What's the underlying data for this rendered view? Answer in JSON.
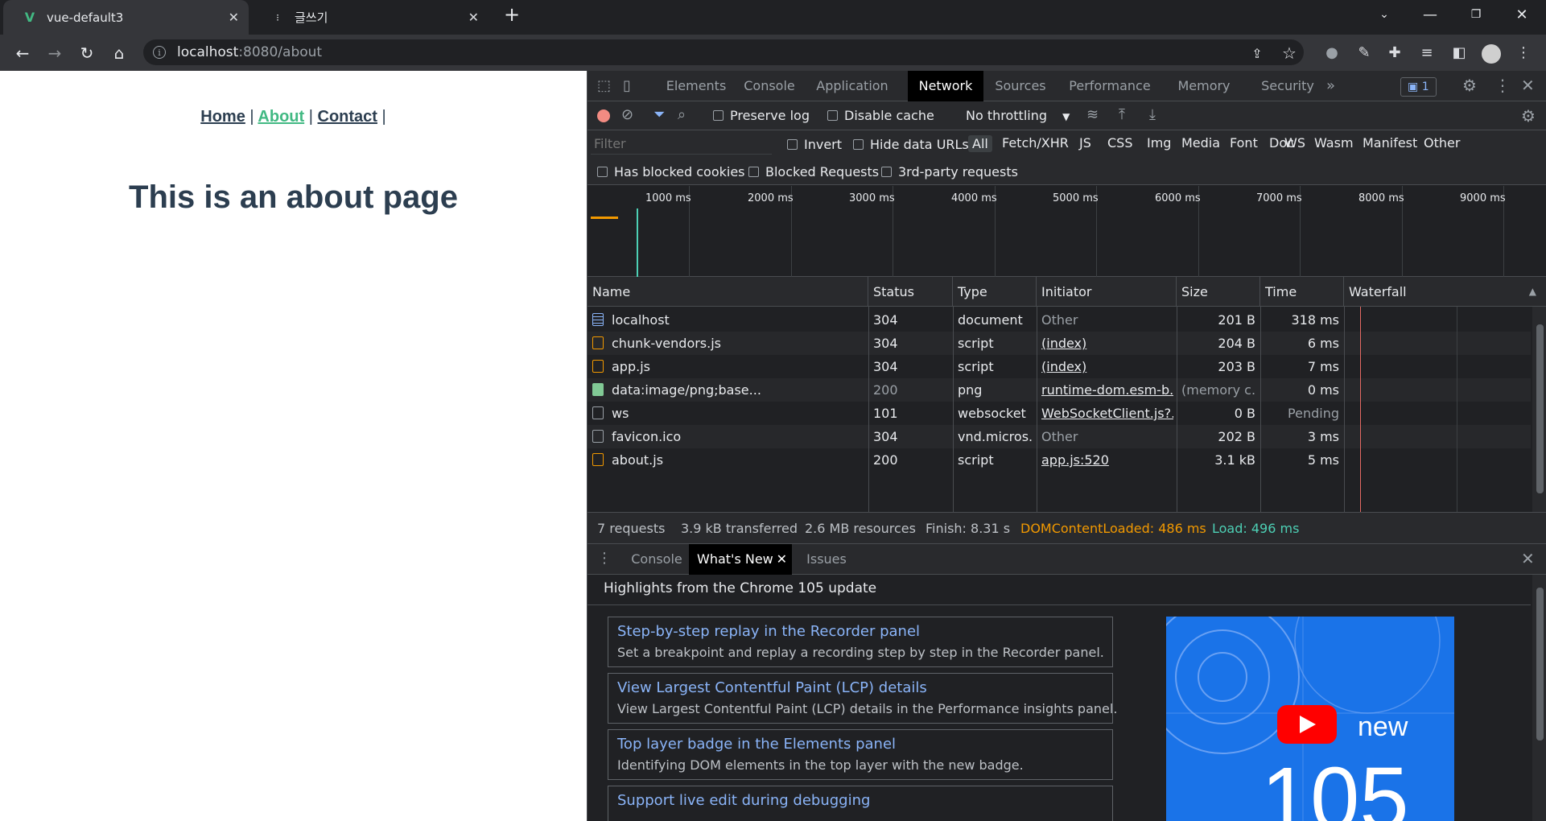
{
  "browser": {
    "tabs": [
      {
        "title": "vue-default3",
        "active": true
      },
      {
        "title": "글쓰기",
        "active": false
      }
    ],
    "url_host": "localhost",
    "url_path": ":8080/about"
  },
  "page": {
    "nav": {
      "home": "Home",
      "about": "About",
      "contact": "Contact",
      "sep": "|"
    },
    "heading": "This is an about page"
  },
  "devtools": {
    "tabs": [
      "Elements",
      "Console",
      "Application",
      "Network",
      "Sources",
      "Performance",
      "Memory",
      "Security"
    ],
    "selected_tab": "Network",
    "issues_badge": "1",
    "toolbar": {
      "preserve_log": "Preserve log",
      "disable_cache": "Disable cache",
      "throttling": "No throttling"
    },
    "filter": {
      "placeholder": "Filter",
      "invert": "Invert",
      "hide_data_urls": "Hide data URLs",
      "types": [
        "All",
        "Fetch/XHR",
        "JS",
        "CSS",
        "Img",
        "Media",
        "Font",
        "Doc",
        "WS",
        "Wasm",
        "Manifest",
        "Other"
      ],
      "has_blocked_cookies": "Has blocked cookies",
      "blocked_requests": "Blocked Requests",
      "third_party": "3rd-party requests"
    },
    "overview_ticks": [
      "1000 ms",
      "2000 ms",
      "3000 ms",
      "4000 ms",
      "5000 ms",
      "6000 ms",
      "7000 ms",
      "8000 ms",
      "9000 ms"
    ],
    "columns": [
      "Name",
      "Status",
      "Type",
      "Initiator",
      "Size",
      "Time",
      "Waterfall"
    ],
    "requests": [
      {
        "name": "localhost",
        "status": "304",
        "type": "document",
        "initiator": "Other",
        "size": "201 B",
        "time": "318 ms",
        "icon": "doc"
      },
      {
        "name": "chunk-vendors.js",
        "status": "304",
        "type": "script",
        "initiator": "(index)",
        "size": "204 B",
        "time": "6 ms",
        "icon": "script"
      },
      {
        "name": "app.js",
        "status": "304",
        "type": "script",
        "initiator": "(index)",
        "size": "203 B",
        "time": "7 ms",
        "icon": "script"
      },
      {
        "name": "data:image/png;base...",
        "status": "200",
        "type": "png",
        "initiator": "runtime-dom.esm-b...",
        "size": "(memory c...",
        "time": "0 ms",
        "icon": "img"
      },
      {
        "name": "ws",
        "status": "101",
        "type": "websocket",
        "initiator": "WebSocketClient.js?...",
        "size": "0 B",
        "time": "Pending",
        "icon": "plain"
      },
      {
        "name": "favicon.ico",
        "status": "304",
        "type": "vnd.micros...",
        "initiator": "Other",
        "size": "202 B",
        "time": "3 ms",
        "icon": "plain"
      },
      {
        "name": "about.js",
        "status": "200",
        "type": "script",
        "initiator": "app.js:520",
        "size": "3.1 kB",
        "time": "5 ms",
        "icon": "script"
      }
    ],
    "summary": {
      "requests": "7 requests",
      "transferred": "3.9 kB transferred",
      "resources": "2.6 MB resources",
      "finish": "Finish: 8.31 s",
      "dcl": "DOMContentLoaded: 486 ms",
      "load": "Load: 496 ms"
    },
    "drawer": {
      "tabs": [
        "Console",
        "What's New",
        "Issues"
      ],
      "selected": "What's New",
      "headline": "Highlights from the Chrome 105 update",
      "cards": [
        {
          "title": "Step-by-step replay in the Recorder panel",
          "desc": "Set a breakpoint and replay a recording step by step in the Recorder panel."
        },
        {
          "title": "View Largest Contentful Paint (LCP) details",
          "desc": "View Largest Contentful Paint (LCP) details in the Performance insights panel."
        },
        {
          "title": "Top layer badge in the Elements panel",
          "desc": "Identifying DOM elements in the top layer with the new badge."
        },
        {
          "title": "Support live edit during debugging",
          "desc": ""
        }
      ],
      "promo_new": "new",
      "promo_version": "105"
    }
  },
  "colors": {
    "vue_green": "#42b983",
    "dcl_orange": "#f29900",
    "load_teal": "#4dd0b5",
    "link_blue": "#8ab4f8"
  }
}
